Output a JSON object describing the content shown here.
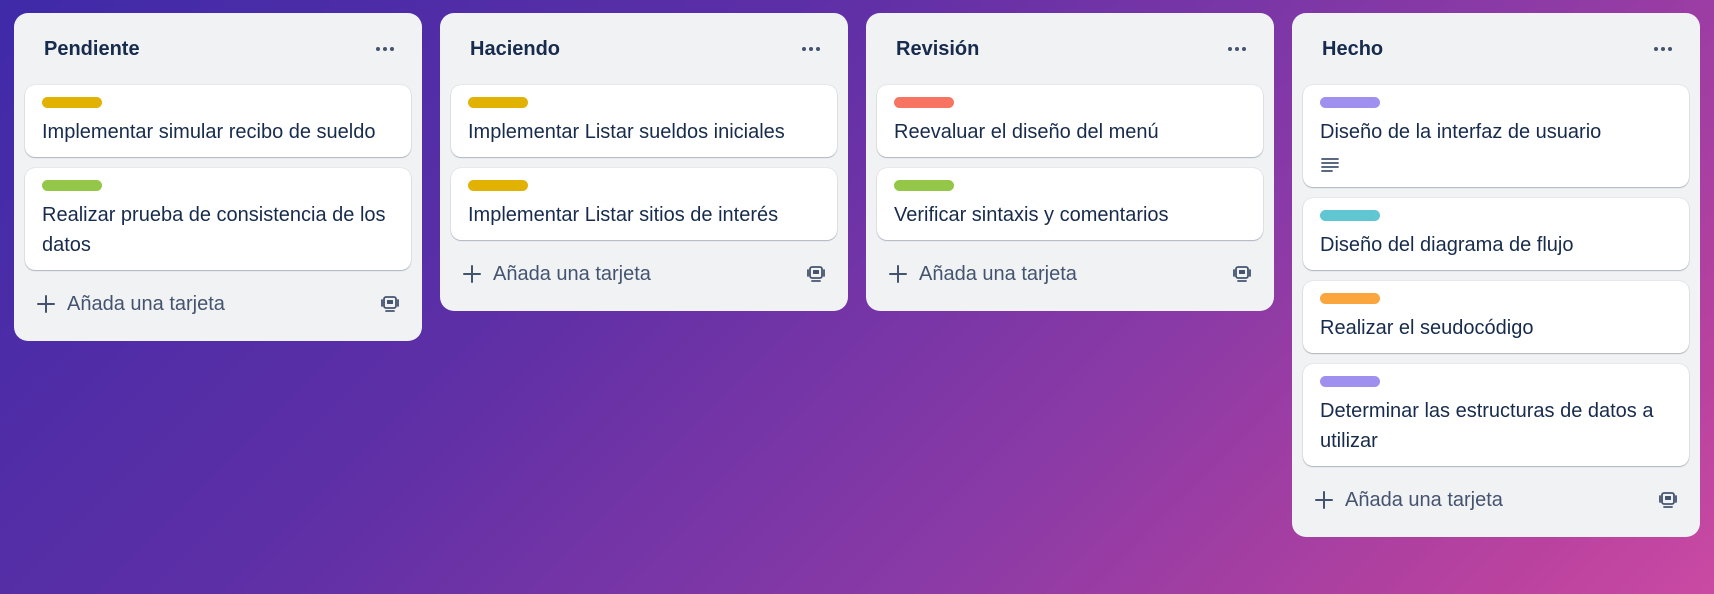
{
  "colors": {
    "yellow": "#e2b203",
    "green": "#94c748",
    "red": "#f87462",
    "purple": "#9f8fef",
    "teal": "#60c6d2",
    "orange": "#faa53d"
  },
  "lists": [
    {
      "title": "Pendiente",
      "add_label": "Añada una tarjeta",
      "cards": [
        {
          "label_color": "#e2b203",
          "title": "Implementar simular recibo de sueldo"
        },
        {
          "label_color": "#94c748",
          "title": "Realizar prueba de consistencia de los datos"
        }
      ]
    },
    {
      "title": "Haciendo",
      "add_label": "Añada una tarjeta",
      "cards": [
        {
          "label_color": "#e2b203",
          "title": "Implementar Listar sueldos iniciales"
        },
        {
          "label_color": "#e2b203",
          "title": "Implementar Listar sitios de interés"
        }
      ]
    },
    {
      "title": "Revisión",
      "add_label": "Añada una tarjeta",
      "cards": [
        {
          "label_color": "#f87462",
          "title": "Reevaluar el diseño del menú"
        },
        {
          "label_color": "#94c748",
          "title": "Verificar sintaxis y comentarios"
        }
      ]
    },
    {
      "title": "Hecho",
      "add_label": "Añada una tarjeta",
      "cards": [
        {
          "label_color": "#9f8fef",
          "title": "Diseño de la interfaz de usuario",
          "has_description": true,
          "description_icon": "description-icon"
        },
        {
          "label_color": "#60c6d2",
          "title": "Diseño del diagrama de flujo"
        },
        {
          "label_color": "#faa53d",
          "title": "Realizar el seudocódigo"
        },
        {
          "label_color": "#9f8fef",
          "title": "Determinar las estructuras de datos a utilizar"
        }
      ]
    }
  ]
}
